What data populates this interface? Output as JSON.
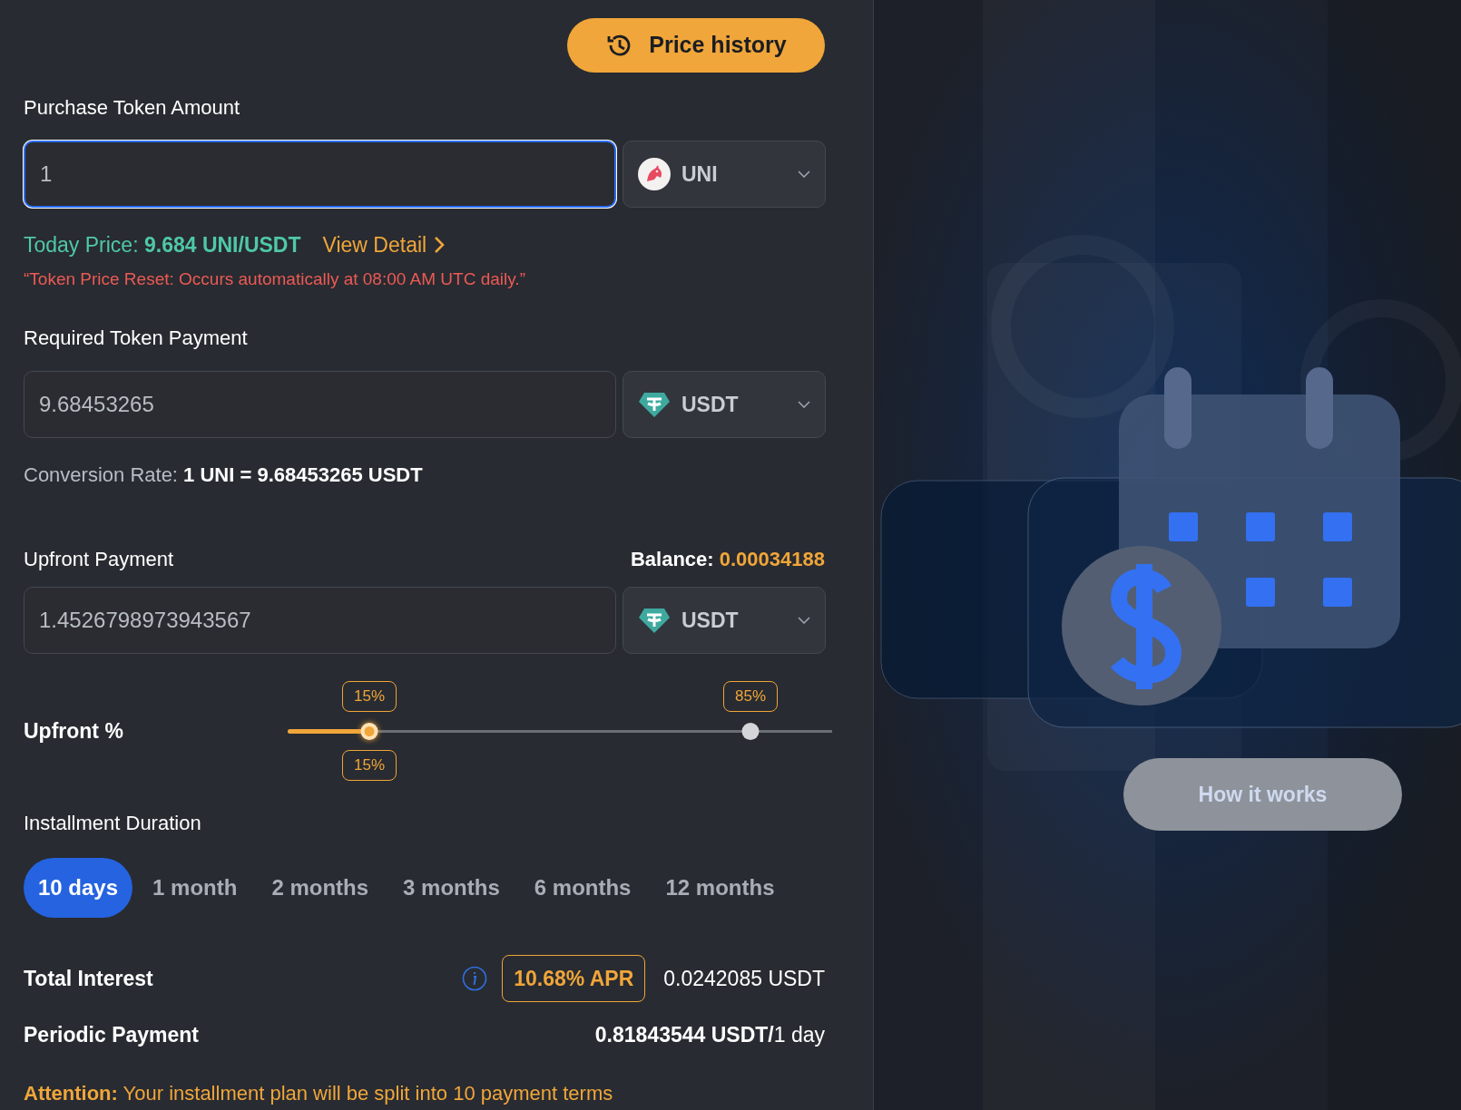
{
  "price_history_button": {
    "label": "Price history"
  },
  "purchase": {
    "label": "Purchase Token Amount",
    "value": "1",
    "focused": true,
    "token": {
      "symbol": "UNI",
      "kind": "uni"
    }
  },
  "today_price": {
    "label": "Today Price:",
    "value": "9.684 UNI/USDT",
    "link": "View Detail"
  },
  "reset_note": "“Token Price Reset: Occurs automatically at 08:00 AM UTC daily.”",
  "required": {
    "label": "Required Token Payment",
    "value": "9.68453265",
    "focused": false,
    "token": {
      "symbol": "USDT",
      "kind": "usdt"
    }
  },
  "conversion": {
    "label": "Conversion Rate:",
    "value": "1 UNI = 9.68453265 USDT"
  },
  "upfront": {
    "label": "Upfront Payment",
    "balance_label": "Balance:",
    "balance": "0.00034188",
    "value": "1.4526798973943567",
    "focused": false,
    "token": {
      "symbol": "USDT",
      "kind": "usdt"
    }
  },
  "upfront_percent": {
    "label": "Upfront %",
    "thumbs": [
      {
        "label": "15%",
        "level": 0.15,
        "active": true
      },
      {
        "label": "85%",
        "level": 0.85,
        "active": false
      }
    ],
    "value_label": "15%"
  },
  "duration": {
    "label": "Installment Duration",
    "options": [
      {
        "label": "10 days",
        "selected": true
      },
      {
        "label": "1 month",
        "selected": false
      },
      {
        "label": "2 months",
        "selected": false
      },
      {
        "label": "3 months",
        "selected": false
      },
      {
        "label": "6 months",
        "selected": false
      },
      {
        "label": "12 months",
        "selected": false
      }
    ]
  },
  "total_interest": {
    "label": "Total Interest",
    "apr": "10.68% APR",
    "value": "0.0242085 USDT"
  },
  "periodic_payment": {
    "label": "Periodic Payment",
    "amount": "0.81843544 USDT/",
    "period": "1 day"
  },
  "attention": {
    "label": "Attention:",
    "text": "Your installment plan will be split into 10 payment terms"
  },
  "how_it_works_button": {
    "label": "How it works"
  }
}
